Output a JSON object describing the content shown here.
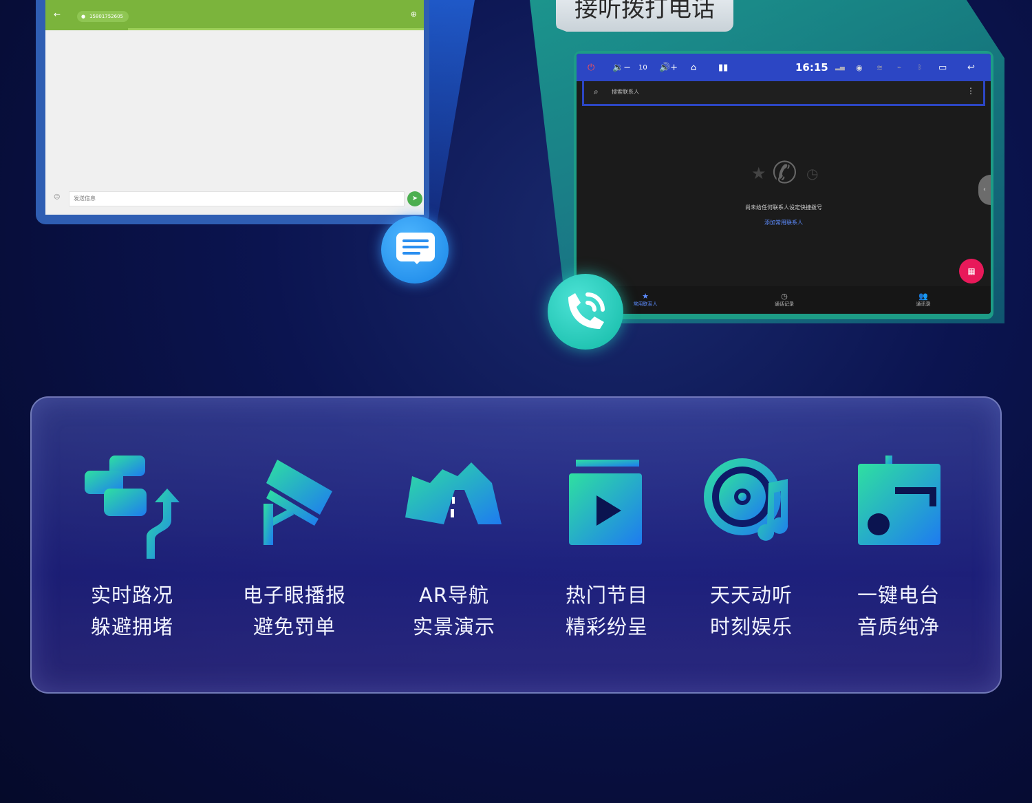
{
  "colors": {
    "sms_bar": "#7bb43c",
    "status_bar": "#2c46c4",
    "fab": "#e8195a",
    "accent_gradient_start": "#2fe0a0",
    "accent_gradient_end": "#1e7bf0"
  },
  "sms_window": {
    "contact_chip": "15801752605",
    "input_placeholder": "发送信息"
  },
  "title_tag": "接听拨打电话",
  "phone_window": {
    "status": {
      "volume_level": "10",
      "time": "16:15"
    },
    "search_placeholder": "搜索联系人",
    "empty_message": "尚未给任何联系人设定快捷拨号",
    "add_favorite_link": "添加常用联系人",
    "nav": [
      {
        "label": "常用联系人"
      },
      {
        "label": "通话记录"
      },
      {
        "label": "通讯录"
      }
    ]
  },
  "features": [
    {
      "icon": "traffic-icon",
      "line1": "实时路况",
      "line2": "躲避拥堵"
    },
    {
      "icon": "camera-icon",
      "line1": "电子眼播报",
      "line2": "避免罚单"
    },
    {
      "icon": "ar-road-icon",
      "line1": "AR导航",
      "line2": "实景演示"
    },
    {
      "icon": "video-play-icon",
      "line1": "热门节目",
      "line2": "精彩纷呈"
    },
    {
      "icon": "music-disc-icon",
      "line1": "天天动听",
      "line2": "时刻娱乐"
    },
    {
      "icon": "radio-icon",
      "line1": "一键电台",
      "line2": "音质纯净"
    }
  ]
}
